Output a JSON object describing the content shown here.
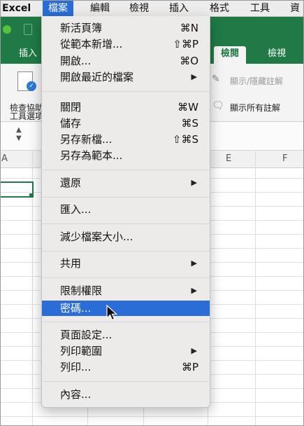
{
  "menubar": {
    "app_name": "Excel",
    "items": [
      "檔案",
      "編輯",
      "檢視",
      "插入",
      "格式",
      "工具",
      "資"
    ]
  },
  "ribbon": {
    "tabs": [
      "插入",
      "檢閱",
      "檢視"
    ],
    "selected_tab": "檢閱",
    "check_accessibility_line1": "檢查協助",
    "check_accessibility_line2": "工具選項",
    "show_hide_comments": "顯示/隱藏註解",
    "show_all_comments": "顯示所有註解"
  },
  "sheet": {
    "column_headers": [
      "A",
      "E",
      "F"
    ]
  },
  "file_menu": {
    "items": [
      {
        "label": "新活頁簿",
        "shortcut": "⌘N"
      },
      {
        "label": "從範本新增...",
        "shortcut": "⇧⌘P"
      },
      {
        "label": "開啟...",
        "shortcut": "⌘O"
      },
      {
        "label": "開啟最近的檔案",
        "shortcut": ""
      },
      {
        "label": "關閉",
        "shortcut": "⌘W"
      },
      {
        "label": "儲存",
        "shortcut": "⌘S"
      },
      {
        "label": "另存新檔...",
        "shortcut": "⇧⌘S"
      },
      {
        "label": "另存為範本...",
        "shortcut": ""
      },
      {
        "label": "還原",
        "shortcut": ""
      },
      {
        "label": "匯入...",
        "shortcut": ""
      },
      {
        "label": "減少檔案大小...",
        "shortcut": ""
      },
      {
        "label": "共用",
        "shortcut": ""
      },
      {
        "label": "限制權限",
        "shortcut": ""
      },
      {
        "label": "密碼...",
        "shortcut": ""
      },
      {
        "label": "頁面設定...",
        "shortcut": ""
      },
      {
        "label": "列印範圍",
        "shortcut": ""
      },
      {
        "label": "列印...",
        "shortcut": "⌘P"
      },
      {
        "label": "內容...",
        "shortcut": ""
      }
    ],
    "highlighted_item": "密碼..."
  },
  "colors": {
    "excel_green": "#1f7a45",
    "highlight_blue": "#2a6dd6",
    "menu_bg": "#ecebe9"
  }
}
